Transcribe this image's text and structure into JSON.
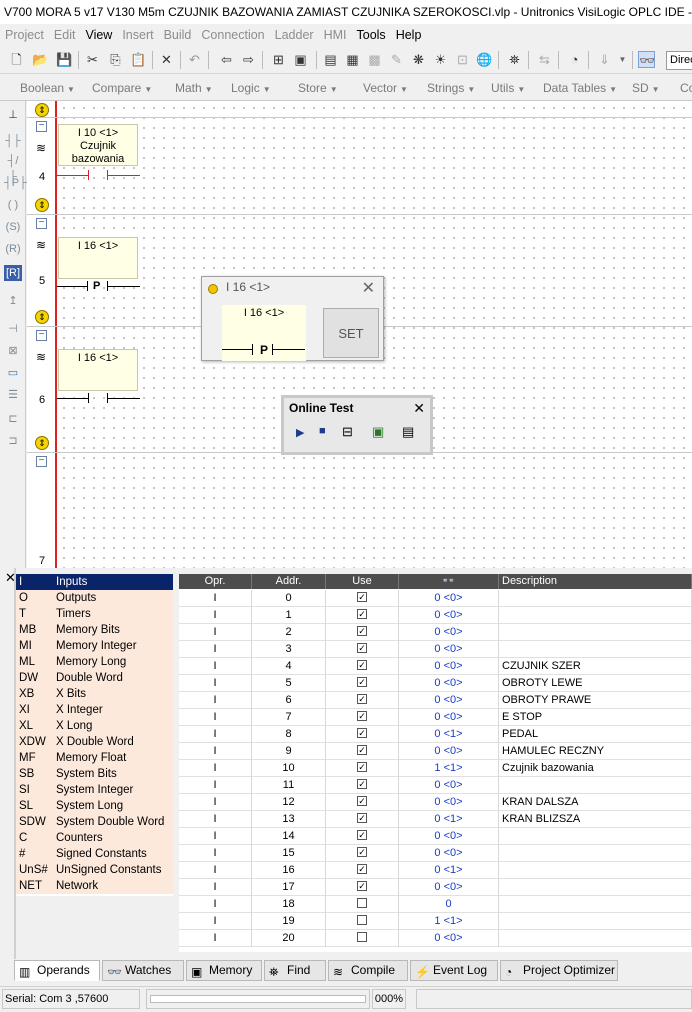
{
  "window": {
    "title": "V700 MORA 5 v17 V130 M5m CZUJNIK BAZOWANIA ZAMIAST CZUJNIKA SZEROKOSCI.vlp - Unitronics VisiLogic OPLC IDE - [La"
  },
  "menu": [
    {
      "label": "Project",
      "enabled": false
    },
    {
      "label": "Edit",
      "enabled": false
    },
    {
      "label": "View",
      "enabled": true
    },
    {
      "label": "Insert",
      "enabled": false
    },
    {
      "label": "Build",
      "enabled": false
    },
    {
      "label": "Connection",
      "enabled": false
    },
    {
      "label": "Ladder",
      "enabled": false
    },
    {
      "label": "HMI",
      "enabled": false
    },
    {
      "label": "Tools",
      "enabled": true
    },
    {
      "label": "Help",
      "enabled": true
    }
  ],
  "toolbar": {
    "combo_value": "Direc"
  },
  "function_bar": [
    "Boolean",
    "Compare",
    "Math",
    "Logic",
    "Store",
    "Vector",
    "Strings",
    "Utils",
    "Data Tables",
    "SD",
    "Co"
  ],
  "ladder": {
    "rung4": {
      "number": "4",
      "operand": "I 10 <1>",
      "desc_line1": "Czujnik",
      "desc_line2": "bazowania"
    },
    "rung5": {
      "number": "5",
      "operand": "I 16 <1>",
      "contact": "P"
    },
    "rung6": {
      "number": "6",
      "operand": "I 16 <1>"
    },
    "rung7": {
      "number": "7"
    }
  },
  "set_dialog": {
    "title": "I 16 <1>",
    "operand": "I 16 <1>",
    "contact": "P",
    "button": "SET"
  },
  "online_test": {
    "title": "Online Test"
  },
  "operands": {
    "categories": [
      {
        "code": "I",
        "name": "Inputs"
      },
      {
        "code": "O",
        "name": "Outputs"
      },
      {
        "code": "T",
        "name": "Timers"
      },
      {
        "code": "MB",
        "name": "Memory Bits"
      },
      {
        "code": "MI",
        "name": "Memory Integer"
      },
      {
        "code": "ML",
        "name": "Memory Long"
      },
      {
        "code": "DW",
        "name": "Double Word"
      },
      {
        "code": "XB",
        "name": "X Bits"
      },
      {
        "code": "XI",
        "name": "X Integer"
      },
      {
        "code": "XL",
        "name": "X Long"
      },
      {
        "code": "XDW",
        "name": "X Double Word"
      },
      {
        "code": "MF",
        "name": "Memory Float"
      },
      {
        "code": "SB",
        "name": "System Bits"
      },
      {
        "code": "SI",
        "name": "System Integer"
      },
      {
        "code": "SL",
        "name": "System Long"
      },
      {
        "code": "SDW",
        "name": "System Double Word"
      },
      {
        "code": "C",
        "name": "Counters"
      },
      {
        "code": "#",
        "name": "Signed Constants"
      },
      {
        "code": "UnS#",
        "name": "UnSigned Constants"
      },
      {
        "code": "NET",
        "name": "Network"
      }
    ],
    "columns": [
      "Opr.",
      "Addr.",
      "Use",
      "Description"
    ],
    "rows": [
      {
        "opr": "I",
        "addr": "0",
        "use": true,
        "value": "0 <0>",
        "desc": ""
      },
      {
        "opr": "I",
        "addr": "1",
        "use": true,
        "value": "0 <0>",
        "desc": ""
      },
      {
        "opr": "I",
        "addr": "2",
        "use": true,
        "value": "0 <0>",
        "desc": ""
      },
      {
        "opr": "I",
        "addr": "3",
        "use": true,
        "value": "0 <0>",
        "desc": ""
      },
      {
        "opr": "I",
        "addr": "4",
        "use": true,
        "value": "0 <0>",
        "desc": "CZUJNIK SZER"
      },
      {
        "opr": "I",
        "addr": "5",
        "use": true,
        "value": "0 <0>",
        "desc": "OBROTY LEWE"
      },
      {
        "opr": "I",
        "addr": "6",
        "use": true,
        "value": "0 <0>",
        "desc": "OBROTY PRAWE"
      },
      {
        "opr": "I",
        "addr": "7",
        "use": true,
        "value": "0 <0>",
        "desc": "E STOP"
      },
      {
        "opr": "I",
        "addr": "8",
        "use": true,
        "value": "0 <1>",
        "desc": "PEDAL"
      },
      {
        "opr": "I",
        "addr": "9",
        "use": true,
        "value": "0 <0>",
        "desc": "HAMULEC RECZNY"
      },
      {
        "opr": "I",
        "addr": "10",
        "use": true,
        "value": "1 <1>",
        "desc": "Czujnik bazowania"
      },
      {
        "opr": "I",
        "addr": "11",
        "use": true,
        "value": "0 <0>",
        "desc": ""
      },
      {
        "opr": "I",
        "addr": "12",
        "use": true,
        "value": "0 <0>",
        "desc": "KRAN DALSZA"
      },
      {
        "opr": "I",
        "addr": "13",
        "use": true,
        "value": "0 <1>",
        "desc": "KRAN BLIZSZA"
      },
      {
        "opr": "I",
        "addr": "14",
        "use": true,
        "value": "0 <0>",
        "desc": ""
      },
      {
        "opr": "I",
        "addr": "15",
        "use": true,
        "value": "0 <0>",
        "desc": ""
      },
      {
        "opr": "I",
        "addr": "16",
        "use": true,
        "value": "0 <1>",
        "desc": ""
      },
      {
        "opr": "I",
        "addr": "17",
        "use": true,
        "value": "0 <0>",
        "desc": ""
      },
      {
        "opr": "I",
        "addr": "18",
        "use": false,
        "value": "0",
        "desc": ""
      },
      {
        "opr": "I",
        "addr": "19",
        "use": false,
        "value": "1 <1>",
        "desc": ""
      },
      {
        "opr": "I",
        "addr": "20",
        "use": false,
        "value": "0 <0>",
        "desc": ""
      }
    ]
  },
  "tabs": [
    "Operands",
    "Watches",
    "Memory",
    "Find",
    "Compile",
    "Event Log",
    "Project Optimizer"
  ],
  "status": {
    "connection": "Serial:  Com 3 ,57600",
    "progress": "000%"
  }
}
